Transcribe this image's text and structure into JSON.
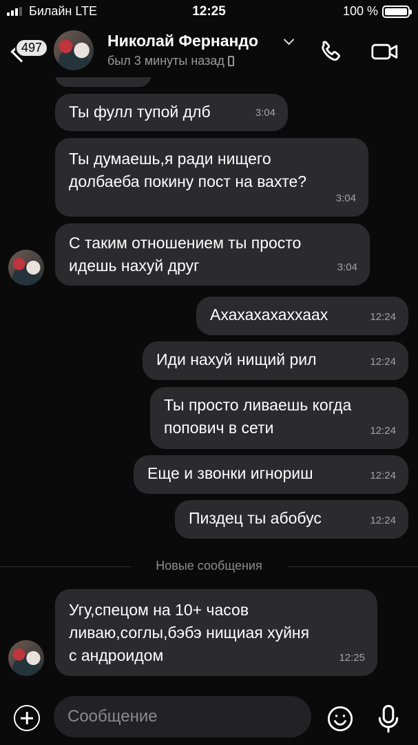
{
  "status_bar": {
    "carrier": "Билайн  LTE",
    "time": "12:25",
    "battery": "100 %"
  },
  "header": {
    "unread_count": "497",
    "contact_name": "Николай Фернандо",
    "last_seen": "был 3 минуты назад"
  },
  "messages": [
    {
      "text": "Ты фулл тупой длб",
      "time": "3:04",
      "direction": "incoming"
    },
    {
      "text": "Ты думаешь,я ради нищего\nдолбаеба покину пост на вахте?",
      "time": "3:04",
      "direction": "incoming"
    },
    {
      "text": "С таким отношением ты просто\nидешь нахуй друг",
      "time": "3:04",
      "direction": "incoming"
    },
    {
      "text": "Ахахахахаххаах",
      "time": "12:24",
      "direction": "outgoing"
    },
    {
      "text": "Иди нахуй нищий рил",
      "time": "12:24",
      "direction": "outgoing"
    },
    {
      "text": "Ты просто ливаешь когда\nпопович в сети",
      "time": "12:24",
      "direction": "outgoing"
    },
    {
      "text": "Еще и звонки игнориш",
      "time": "12:24",
      "direction": "outgoing"
    },
    {
      "text": "Пиздец ты абобус",
      "time": "12:24",
      "direction": "outgoing"
    },
    {
      "text": "Угу,спецом на 10+ часов\nливаю,соглы,бэбэ нищиая хуйня\nс андроидом",
      "time": "12:25",
      "direction": "incoming"
    }
  ],
  "divider": {
    "label": "Новые сообщения"
  },
  "composer": {
    "placeholder": "Сообщение"
  }
}
